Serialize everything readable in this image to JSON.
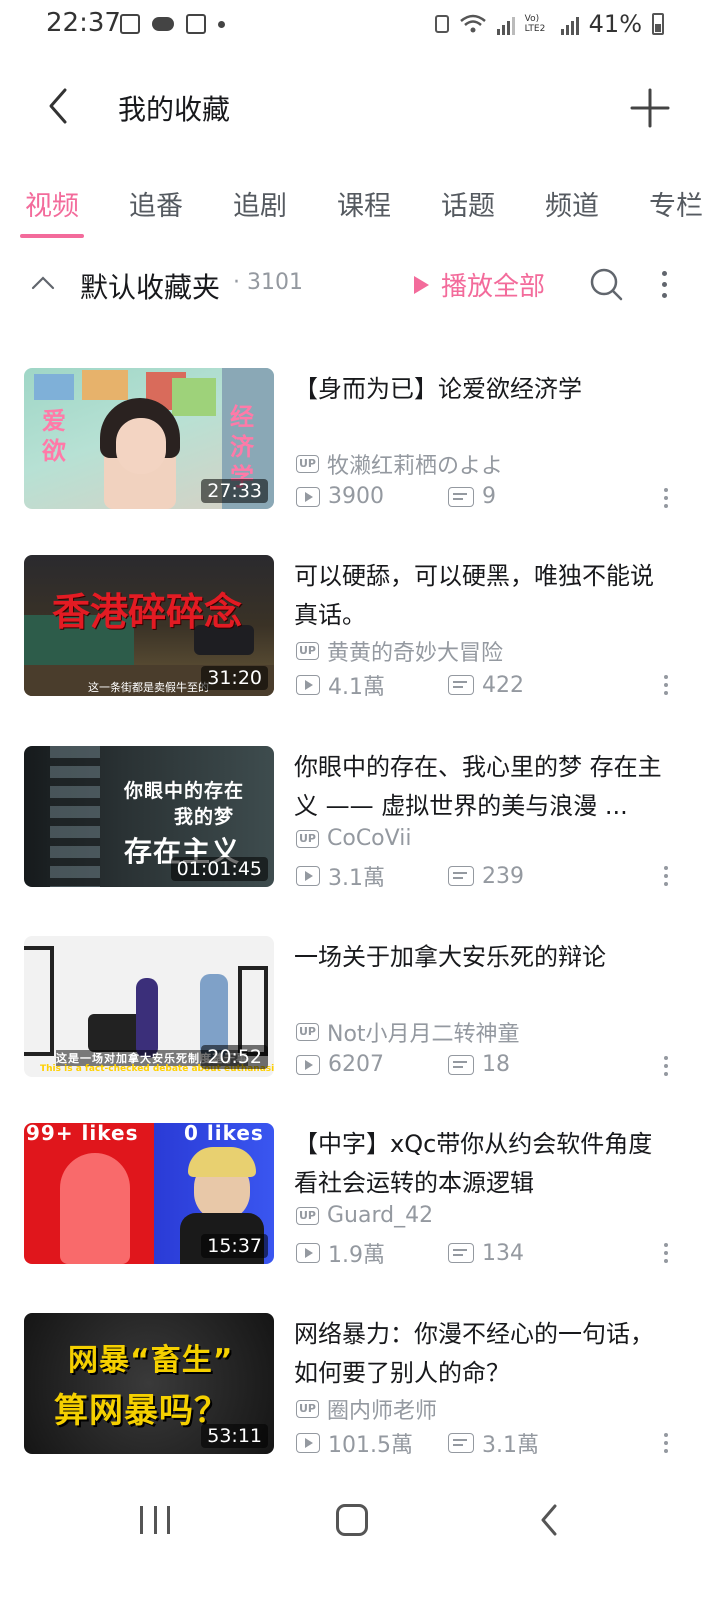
{
  "status_bar": {
    "time": "22:37",
    "battery": "41%",
    "network_label": "Vo) LTE2"
  },
  "header": {
    "title": "我的收藏",
    "back_icon": "chevron-left-icon",
    "add_icon": "plus-icon"
  },
  "tabs": [
    {
      "label": "视频",
      "active": true
    },
    {
      "label": "追番",
      "active": false
    },
    {
      "label": "追剧",
      "active": false
    },
    {
      "label": "课程",
      "active": false
    },
    {
      "label": "话题",
      "active": false
    },
    {
      "label": "频道",
      "active": false
    },
    {
      "label": "专栏",
      "active": false
    }
  ],
  "folder": {
    "name": "默认收藏夹",
    "count": "· 3101",
    "play_all": "播放全部"
  },
  "colors": {
    "accent": "#f36b9b",
    "text_primary": "#18191c",
    "text_secondary": "#9499a0"
  },
  "videos": [
    {
      "title": "【身而为已】论爱欲经济学",
      "uploader": "牧濑红莉栖のよよ",
      "views": "3900",
      "danmaku": "9",
      "duration": "27:33",
      "thumb_texts": [
        "爱\n欲",
        "经\n济\n学"
      ]
    },
    {
      "title": "可以硬舔，可以硬黑，唯独不能说真话。",
      "uploader": "黄黄的奇妙大冒险",
      "views": "4.1萬",
      "danmaku": "422",
      "duration": "31:20",
      "thumb_texts": [
        "香港碎碎念",
        "这一条街都是卖假牛至的"
      ]
    },
    {
      "title": "你眼中的存在、我心里的梦 存在主义 —— 虚拟世界的美与浪漫 ...",
      "uploader": "CoCoVii",
      "views": "3.1萬",
      "danmaku": "239",
      "duration": "01:01:45",
      "thumb_texts": [
        "你眼中的存在",
        "我的梦",
        "存在主义"
      ]
    },
    {
      "title": "一场关于加拿大安乐死的辩论",
      "uploader": "Not小月月二转神童",
      "views": "6207",
      "danmaku": "18",
      "duration": "20:52",
      "thumb_texts": [
        "这是一场对加拿大安乐死制度基于事",
        "This is a fact-checked debate about euthanasia in Canada."
      ]
    },
    {
      "title": "【中字】xQc带你从约会软件角度看社会运转的本源逻辑",
      "uploader": "Guard_42",
      "views": "1.9萬",
      "danmaku": "134",
      "duration": "15:37",
      "thumb_texts": [
        "99+ likes",
        "0 likes"
      ]
    },
    {
      "title": "网络暴力：你漫不经心的一句话，如何要了别人的命？",
      "uploader": "圈内师老师",
      "views": "101.5萬",
      "danmaku": "3.1萬",
      "duration": "53:11",
      "thumb_texts": [
        "网暴“畜生”",
        "算网暴吗？"
      ]
    }
  ]
}
